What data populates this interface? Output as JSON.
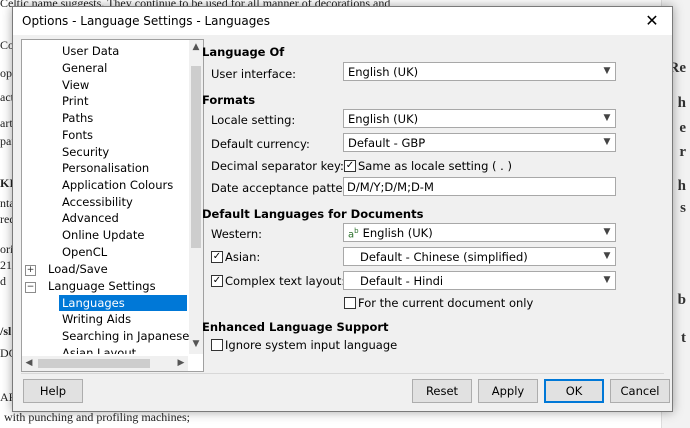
{
  "background_doc": {
    "lines": [
      "Celtic name suggests.  They continue to be used for all manner of decorations and",
      "Cou",
      "opti",
      "acti",
      "arti",
      "pare",
      "KIN",
      "nta",
      "red",
      "ori",
      "21",
      "d",
      "/sl",
      "DO",
      "AP",
      "with punching and profiling machines;"
    ],
    "right_letters": [
      "Re",
      "h",
      "e",
      "r",
      "h",
      "s",
      "b",
      "t"
    ]
  },
  "dialog": {
    "title": "Options - Language Settings - Languages",
    "close_glyph": "✕"
  },
  "tree": {
    "items": [
      {
        "label": "User Data",
        "level": 2
      },
      {
        "label": "General",
        "level": 2
      },
      {
        "label": "View",
        "level": 2
      },
      {
        "label": "Print",
        "level": 2
      },
      {
        "label": "Paths",
        "level": 2
      },
      {
        "label": "Fonts",
        "level": 2
      },
      {
        "label": "Security",
        "level": 2
      },
      {
        "label": "Personalisation",
        "level": 2
      },
      {
        "label": "Application Colours",
        "level": 2
      },
      {
        "label": "Accessibility",
        "level": 2
      },
      {
        "label": "Advanced",
        "level": 2
      },
      {
        "label": "Online Update",
        "level": 2
      },
      {
        "label": "OpenCL",
        "level": 2
      },
      {
        "label": "Load/Save",
        "level": 1,
        "expander": "+"
      },
      {
        "label": "Language Settings",
        "level": 1,
        "expander": "−"
      },
      {
        "label": "Languages",
        "level": 2,
        "selected": true
      },
      {
        "label": "Writing Aids",
        "level": 2
      },
      {
        "label": "Searching in Japanese",
        "level": 2
      },
      {
        "label": "Asian Layout",
        "level": 2
      }
    ]
  },
  "language_of": {
    "heading": "Language Of",
    "user_interface_label": "User interface:",
    "user_interface_value": "English (UK)"
  },
  "formats": {
    "heading": "Formats",
    "locale_label": "Locale setting:",
    "locale_value": "English (UK)",
    "currency_label": "Default currency:",
    "currency_value": "Default - GBP",
    "decimal_label": "Decimal separator key:",
    "decimal_checkbox_label": "Same as locale setting ( . )",
    "decimal_checked": true,
    "date_label": "Date acceptance patterns:",
    "date_value": "D/M/Y;D/M;D-M"
  },
  "default_languages": {
    "heading": "Default Languages for Documents",
    "western_label": "Western:",
    "western_value": "English (UK)",
    "western_icon": "spellcheck-icon",
    "asian_label": "Asian:",
    "asian_checked": true,
    "asian_value": "Default - Chinese (simplified)",
    "ctl_label": "Complex text layout:",
    "ctl_checked": true,
    "ctl_value": "Default - Hindi",
    "current_doc_label": "For the current document only",
    "current_doc_checked": false
  },
  "enhanced": {
    "heading": "Enhanced Language Support",
    "ignore_label": "Ignore system input language",
    "ignore_checked": false
  },
  "buttons": {
    "help": "Help",
    "reset": "Reset",
    "apply": "Apply",
    "ok": "OK",
    "cancel": "Cancel"
  },
  "colors": {
    "selection": "#0078d7",
    "dialog_bg": "#f0f0f0"
  }
}
